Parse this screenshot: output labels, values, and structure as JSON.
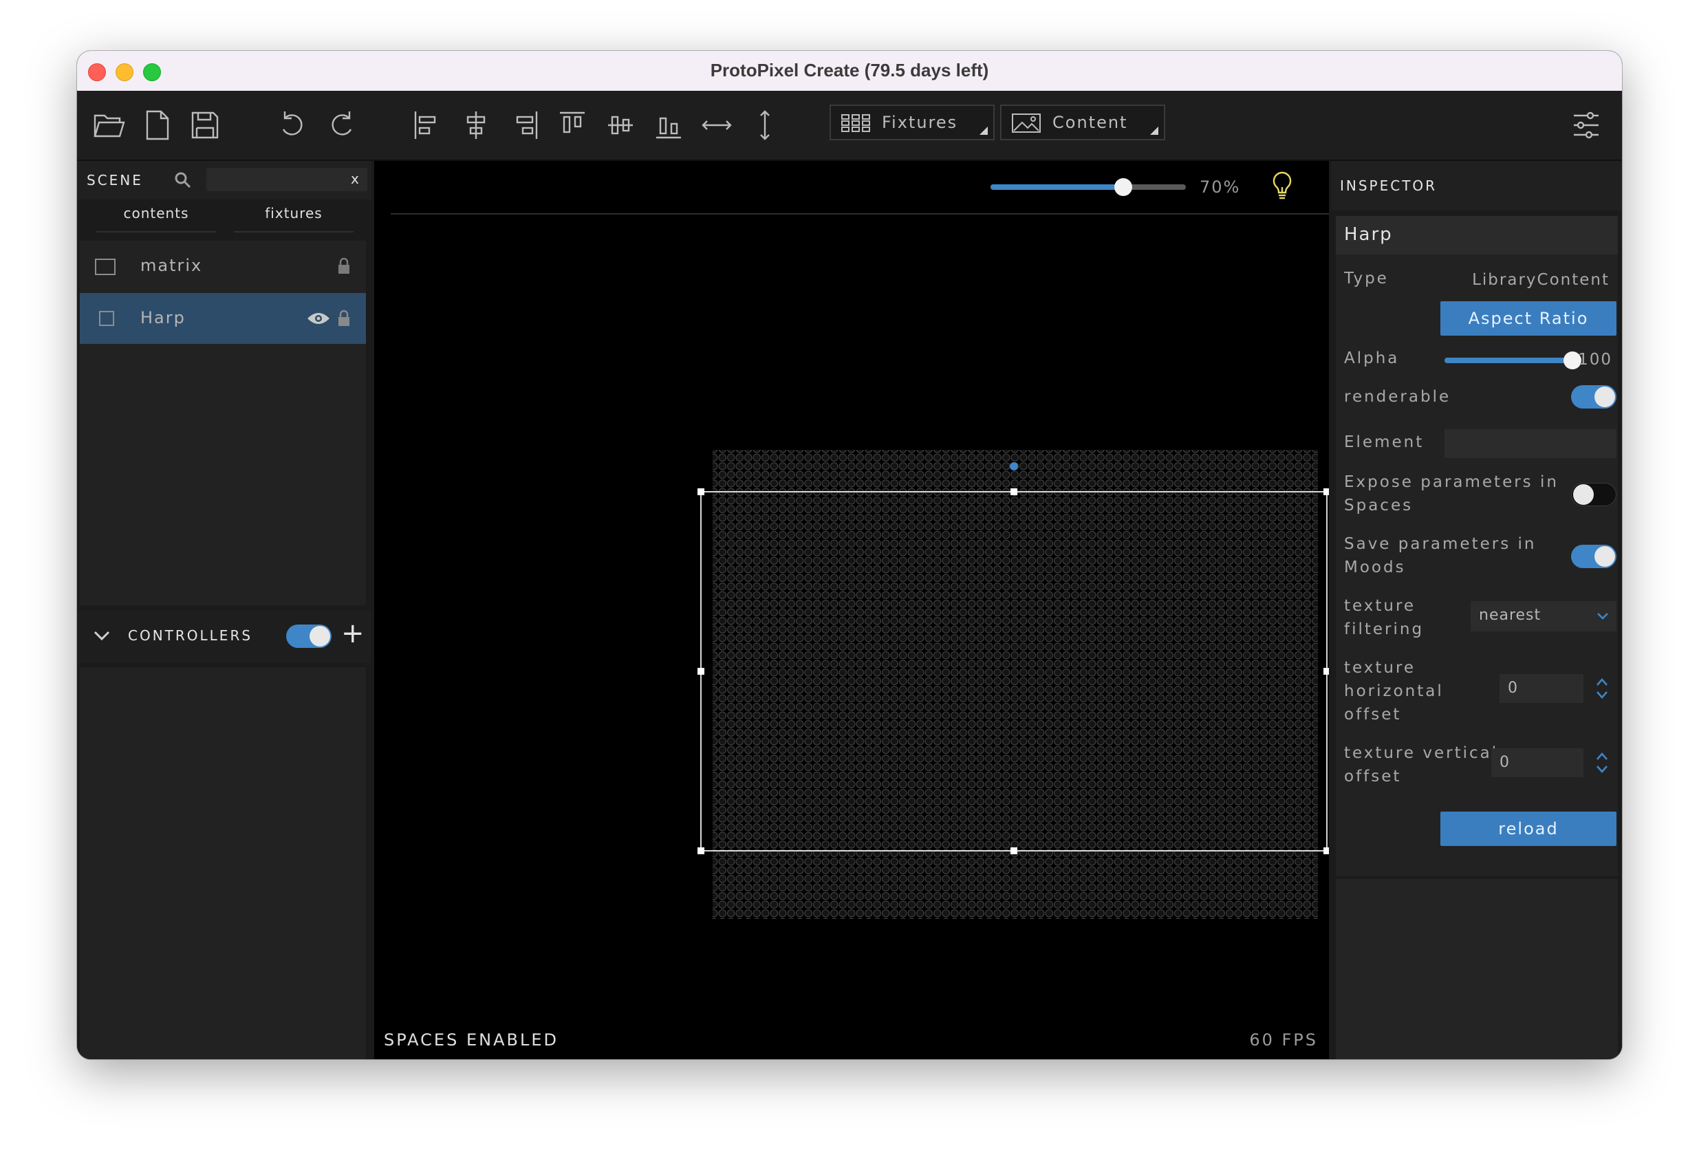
{
  "window": {
    "title": "ProtoPixel Create (79.5 days left)"
  },
  "toolbar": {
    "fixtures_label": "Fixtures",
    "content_label": "Content"
  },
  "scene": {
    "label": "SCENE",
    "search_placeholder": "",
    "search_clear": "x",
    "tabs": [
      "contents",
      "fixtures"
    ],
    "items": [
      {
        "name": "matrix",
        "selected": false
      },
      {
        "name": "Harp",
        "selected": true
      }
    ]
  },
  "controllers": {
    "label": "CONTROLLERS",
    "enabled": true,
    "add": "+"
  },
  "viewport": {
    "zoom_percent": 70,
    "zoom_label": "70%",
    "status_left": "SPACES ENABLED",
    "status_right": "60 FPS",
    "accent": "#3e86c8"
  },
  "inspector": {
    "label": "INSPECTOR",
    "title": "Harp",
    "type_label": "Type",
    "type_value": "LibraryContent",
    "aspect_button": "Aspect Ratio",
    "alpha_label": "Alpha",
    "alpha_value": "100",
    "alpha_fraction": 1.0,
    "renderable_label": "renderable",
    "renderable": true,
    "element_label": "Element",
    "element_value": "",
    "expose_label_1": "Expose parameters in",
    "expose_label_2": "Spaces",
    "expose": false,
    "save_label_1": "Save parameters in",
    "save_label_2": "Moods",
    "save": true,
    "filter_label_1": "texture",
    "filter_label_2": "filtering",
    "filter_value": "nearest",
    "hoff_label_1": "texture",
    "hoff_label_2": "horizontal",
    "hoff_label_3": "offset",
    "hoff_value": "0",
    "voff_label_1": "texture vertical",
    "voff_label_2": "offset",
    "voff_value": "0",
    "reload_button": "reload",
    "button_color": "#3a7ec0"
  }
}
